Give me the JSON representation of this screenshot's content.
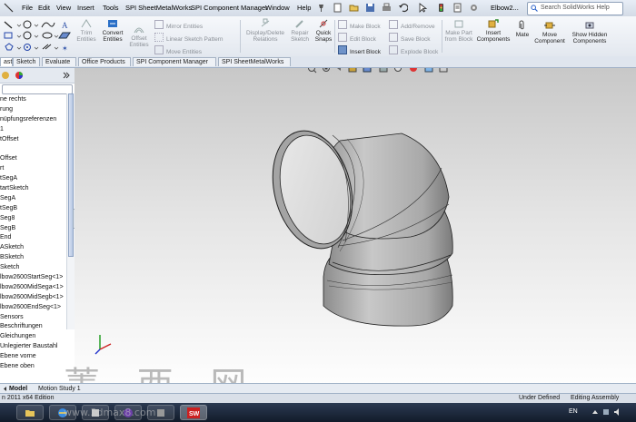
{
  "menu": {
    "items": [
      "File",
      "Edit",
      "View",
      "Insert",
      "Tools",
      "SPI SheetMetalWorks",
      "SPI Component Manager",
      "Window",
      "Help"
    ],
    "window_title": "Elbow2...",
    "search_placeholder": "Search SolidWorks Help"
  },
  "ribbon": {
    "trim": "Trim Entities",
    "convert": "Convert Entities",
    "offset": "Offset Entities",
    "mirror": "Mirror Entities",
    "linear_pattern": "Linear Sketch Pattern",
    "move": "Move Entities",
    "display_delete": "Display/Delete Relations",
    "repair": "Repair Sketch",
    "quick_snaps": "Quick Snaps",
    "make_block": "Make Block",
    "edit_block": "Edit Block",
    "insert_block": "Insert Block",
    "add_remove": "Add/Remove",
    "save_block": "Save Block",
    "explode_block": "Explode Block",
    "make_part": "Make Part from Block",
    "insert_components": "Insert Components",
    "mate": "Mate",
    "move_component": "Move Component",
    "show_hidden": "Show Hidden Components"
  },
  "tabs": [
    "ast",
    "Sketch",
    "Evaluate",
    "Office Products",
    "SPI Component Manager",
    "SPI SheetMetalWorks"
  ],
  "tree": [
    "ne rechts",
    "rung",
    "nüpfungsreferenzen",
    "1",
    "tOffset",
    "",
    "Offset",
    "rt",
    "tSegA",
    "tartSketch",
    "SegA",
    "tSegB",
    "Seg8",
    "SegB",
    "End",
    "ASketch",
    "BSketch",
    "Sketch",
    "lbow2600StartSeg<1>",
    "lbow2600MidSega<1>",
    "lbow2600MidSegb<1>",
    "lbow2600EndSeg<1>",
    "Sensors",
    "Beschriftungen",
    "Gleichungen",
    "Unlegierter Baustahl",
    "Ebene vorne",
    "Ebene oben"
  ],
  "bottom_tabs": {
    "model": "Model",
    "motion": "Motion Study 1"
  },
  "status": {
    "left": "n 2011 x64 Edition",
    "under_defined": "Under Defined",
    "editing": "Editing Assembly"
  },
  "taskbar": {
    "lang": "EN"
  },
  "watermark": {
    "big": "菁 西 网",
    "url": "www.3dmax8.com"
  },
  "colors": {
    "viewport_top": "#c8c8c8",
    "viewport_bottom": "#ffffff",
    "model_fill": "#b7b7b7",
    "taskbar": "#1b2638"
  }
}
